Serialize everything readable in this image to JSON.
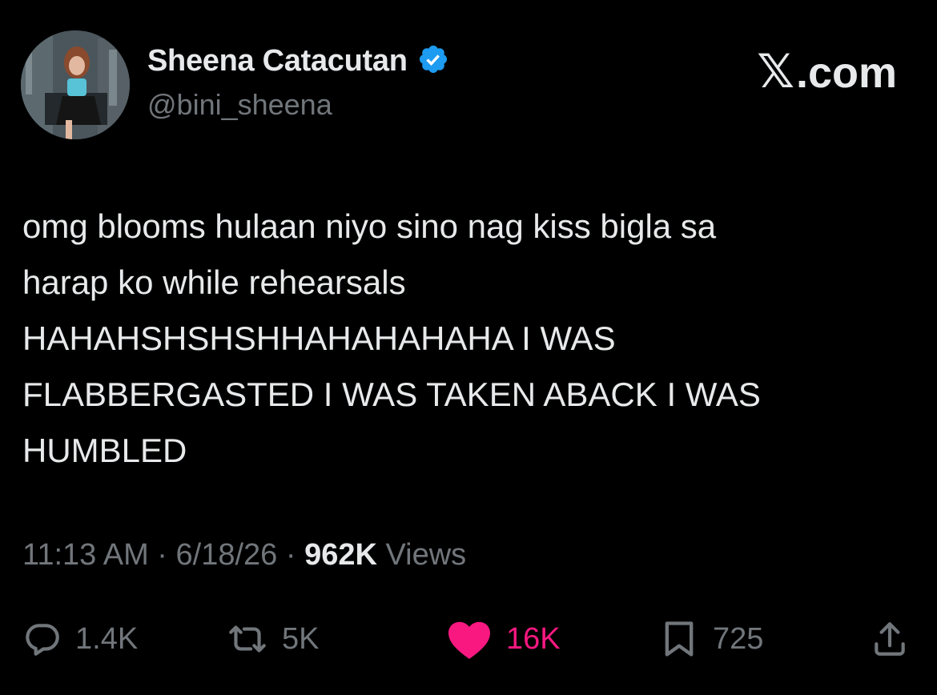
{
  "colors": {
    "background": "#000000",
    "primary_text": "#e7e9ea",
    "secondary_text": "#71767b",
    "verified_blue": "#1d9bf0",
    "like_pink": "#f91880"
  },
  "header": {
    "display_name": "Sheena Catacutan",
    "handle": "@bini_sheena",
    "verified_icon": "verified-badge-icon",
    "brand_mark": "𝕏",
    "brand_suffix": ".com"
  },
  "tweet": {
    "lines": [
      "omg blooms hulaan niyo sino nag kiss bigla sa",
      "harap ko while rehearsals",
      "HAHAHSHSHSHHAHAHAHAHA I WAS",
      "FLABBERGASTED I WAS TAKEN ABACK I WAS",
      "HUMBLED"
    ]
  },
  "meta": {
    "time": "11:13 AM",
    "separator": "·",
    "date": "6/18/26",
    "views_count": "962K",
    "views_label": "Views"
  },
  "actions": {
    "reply": {
      "icon": "reply-icon",
      "count": "1.4K"
    },
    "repost": {
      "icon": "repost-icon",
      "count": "5K"
    },
    "like": {
      "icon": "heart-icon",
      "count": "16K"
    },
    "bookmark": {
      "icon": "bookmark-icon",
      "count": "725"
    },
    "share": {
      "icon": "share-icon"
    }
  }
}
